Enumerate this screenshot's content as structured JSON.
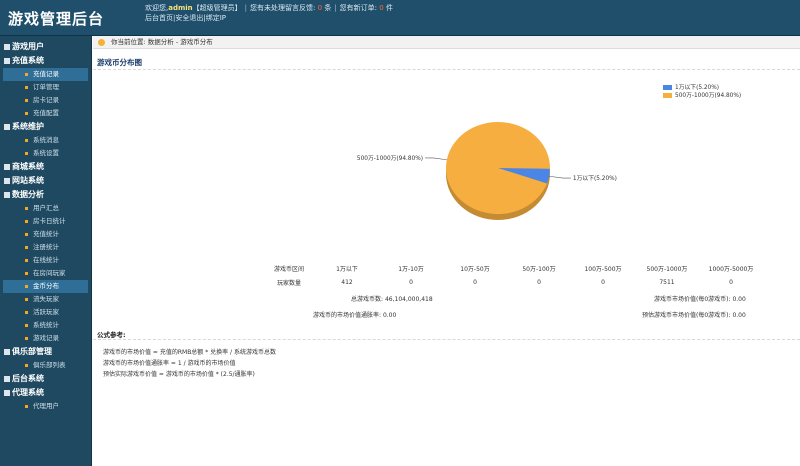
{
  "header": {
    "title": "游戏管理后台",
    "welcome": "欢迎您,",
    "username": "admin",
    "role": "【超级管理员】",
    "pending_feedback_label": "您有未处理留言反馈:",
    "pending_feedback_count": "0",
    "pending_feedback_unit": "条",
    "new_orders_label": "您有新订单:",
    "new_orders_count": "0",
    "new_orders_unit": "件",
    "links": [
      "后台首页",
      "安全退出",
      "绑定IP"
    ]
  },
  "sidebar": {
    "groups": [
      {
        "label": "游戏用户",
        "items": []
      },
      {
        "label": "充值系统",
        "items": [
          "充值记录",
          "订单管理",
          "房卡记录",
          "充值配置"
        ]
      },
      {
        "label": "系统维护",
        "items": [
          "系统消息",
          "系统设置"
        ]
      },
      {
        "label": "商城系统",
        "items": []
      },
      {
        "label": "网站系统",
        "items": []
      },
      {
        "label": "数据分析",
        "items": [
          "用户汇总",
          "房卡日统计",
          "充值统计",
          "注册统计",
          "在线统计",
          "在房间玩家",
          "金币分布",
          "流失玩家",
          "活跃玩家",
          "系统统计",
          "游戏记录"
        ]
      },
      {
        "label": "俱乐部管理",
        "items": [
          "俱乐部列表"
        ]
      },
      {
        "label": "后台系统",
        "items": []
      },
      {
        "label": "代理系统",
        "items": [
          "代理用户"
        ]
      }
    ],
    "active_item": "金币分布"
  },
  "breadcrumb": {
    "prefix": "你当前位置:",
    "path": "数据分析 - 游戏币分布"
  },
  "section_title": "游戏币分布图",
  "chart_data": {
    "type": "pie",
    "title": "",
    "labels": [
      "1万以下",
      "500万-1000万"
    ],
    "values": [
      5.2,
      94.8
    ],
    "colors": [
      "#4a86e8",
      "#f5ae3f"
    ],
    "slice_labels": [
      "1万以下(5.20%)",
      "500万-1000万(94.80%)"
    ],
    "legend_position": "top-right"
  },
  "stats": {
    "row1_header": "游戏币区间",
    "ranges": [
      "1万以下",
      "1万-10万",
      "10万-50万",
      "50万-100万",
      "100万-500万",
      "500万-1000万",
      "1000万-5000万"
    ],
    "row2_header": "玩家数量",
    "counts": [
      "412",
      "0",
      "0",
      "0",
      "0",
      "7511",
      "0"
    ],
    "total_label": "总游戏币数:",
    "total_value": "46,104,000,418",
    "market_value_label": "游戏币市场价值(每0游戏币):",
    "market_value": "0.00",
    "inflation_label": "游戏币的市场价值通胀率:",
    "inflation_value": "0.00",
    "est_market_label": "预估游戏币市场价值(每0游戏币):",
    "est_market_value": "0.00"
  },
  "formulas": {
    "title": "公式参考:",
    "lines": [
      "游戏币的市场价值 = 充值的RMB总额 * 兑换率 / 系统游戏币总数",
      "游戏币的市场价值通胀率 = 1 / 游戏币的市场价值",
      "预估实际游戏币价值 = 游戏币的市场价值 * (2.5/通胀率)"
    ]
  }
}
